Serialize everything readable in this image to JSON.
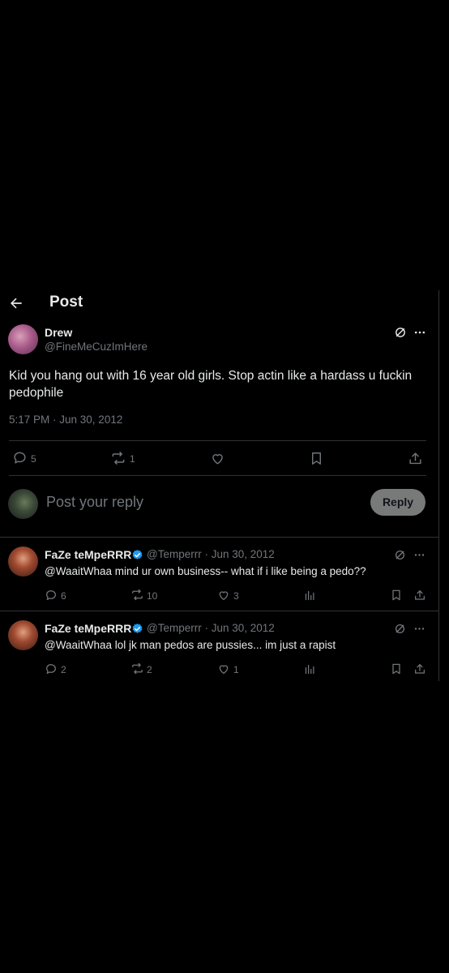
{
  "header": {
    "title": "Post"
  },
  "main_post": {
    "author_name": "Drew",
    "handle": "@FineMeCuzImHere",
    "text_line1": "Kid you hang out with 16 year old girls. Stop actin like a hardass u fuckin",
    "text_line2": "pedophile",
    "timestamp": "5:17 PM · Jun 30, 2012",
    "replies": "5",
    "reposts": "1"
  },
  "composer": {
    "placeholder": "Post your reply",
    "reply_label": "Reply"
  },
  "replies": [
    {
      "author_name": "FaZe teMpeRRR",
      "handle_date": "@Temperrr · Jun 30, 2012",
      "text": "@WaaitWhaa mind ur own business-- what if i like being a pedo??",
      "replies": "6",
      "reposts": "10",
      "likes": "3"
    },
    {
      "author_name": "FaZe teMpeRRR",
      "handle_date": "@Temperrr · Jun 30, 2012",
      "text": "@WaaitWhaa lol jk man pedos are pussies... im just a rapist",
      "replies": "2",
      "reposts": "2",
      "likes": "1"
    }
  ],
  "colors": {
    "background": "#000000",
    "text": "#e7e9ea",
    "muted": "#71767b",
    "border": "#2f3336",
    "verified": "#1d9bf0"
  }
}
